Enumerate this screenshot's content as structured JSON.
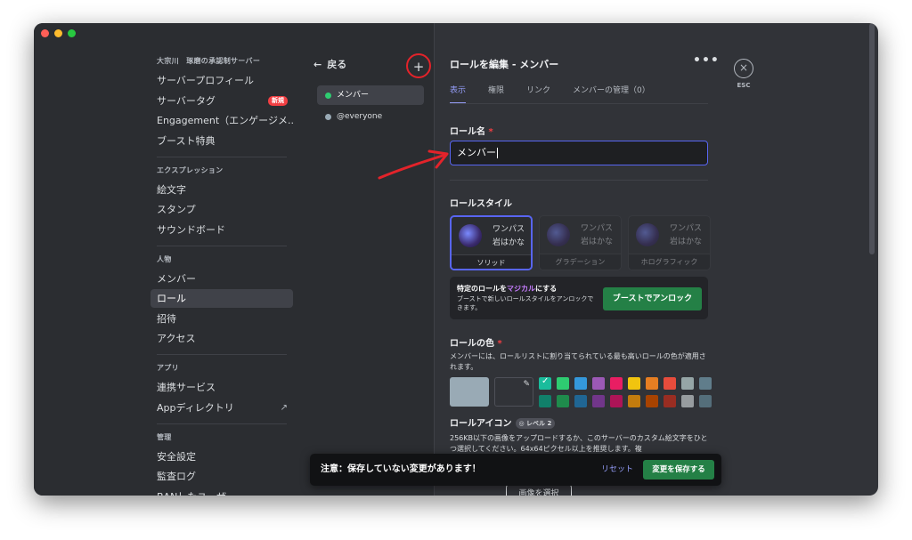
{
  "sidebar": {
    "server_header": "大宗川　琢磨の承認制サーバー",
    "server_items": [
      {
        "label": "サーバープロフィール"
      },
      {
        "label": "サーバータグ",
        "badge": "新規"
      },
      {
        "label": "Engagement（エンゲージメ..."
      },
      {
        "label": "ブースト特典"
      }
    ],
    "expr_header": "エクスプレッション",
    "expr_items": [
      {
        "label": "絵文字"
      },
      {
        "label": "スタンプ"
      },
      {
        "label": "サウンドボード"
      }
    ],
    "people_header": "人物",
    "people_items": [
      {
        "label": "メンバー"
      },
      {
        "label": "ロール"
      },
      {
        "label": "招待"
      },
      {
        "label": "アクセス"
      }
    ],
    "apps_header": "アプリ",
    "apps_items": [
      {
        "label": "連携サービス"
      },
      {
        "label": "Appディレクトリ"
      }
    ],
    "manage_header": "管理",
    "manage_items": [
      {
        "label": "安全設定"
      },
      {
        "label": "監査ログ"
      },
      {
        "label": "BANしたユーザー"
      }
    ]
  },
  "rolelist": {
    "back_label": "戻る",
    "add_label": "+",
    "roles": [
      {
        "name": "メンバー",
        "color": "#2ecc71"
      },
      {
        "name": "@everyone",
        "color": "#99aab5"
      }
    ]
  },
  "editor": {
    "title": "ロールを編集 - メンバー",
    "more_label": "•••",
    "tabs": [
      "表示",
      "権限",
      "リンク",
      "メンバーの管理（0）"
    ],
    "role_name_label": "ロール名",
    "required_mark": "*",
    "role_name_value": "メンバー",
    "role_style_label": "ロールスタイル",
    "style_cards": [
      {
        "name": "ワンパス",
        "sub": "岩はかな",
        "label": "ソリッド"
      },
      {
        "name": "ワンパス",
        "sub": "岩はかな",
        "label": "グラデーション"
      },
      {
        "name": "ワンパス",
        "sub": "岩はかな",
        "label": "ホログラフィック"
      }
    ],
    "boost_title_pre": "特定のロールを",
    "boost_title_mag": "マジカル",
    "boost_title_post": "にする",
    "boost_desc": "ブーストで新しいロールスタイルをアンロックできます。",
    "boost_button": "ブーストでアンロック",
    "role_color_label": "ロールの色",
    "role_color_desc": "メンバーには、ロールリストに割り当てられている最も高いロールの色が適用されます。",
    "default_color": "#99aab5",
    "swatch_colors": [
      "#1abc9c",
      "#2ecc71",
      "#3498db",
      "#9b59b6",
      "#e91e63",
      "#f1c40f",
      "#e67e22",
      "#e74c3c",
      "#95a5a6",
      "#607d8b",
      "#11806a",
      "#1f8b4c",
      "#206694",
      "#71368a",
      "#ad1457",
      "#c27c0e",
      "#a84300",
      "#992d22",
      "#979c9f",
      "#546e7a"
    ],
    "role_icon_label": "ロールアイコン",
    "role_icon_badge": "レベル 2",
    "role_icon_desc": "256KB以下の画像をアップロードするか、このサーバーのカスタム絵文字をひとつ選択してください。64x64ピクセル以上を推奨します。複",
    "select_image_button": "画像を選択"
  },
  "esc": {
    "icon": "×",
    "label": "ESC"
  },
  "notice": {
    "text": "注意：保存していない変更があります！",
    "reset_label": "リセット",
    "save_label": "変更を保存する"
  }
}
